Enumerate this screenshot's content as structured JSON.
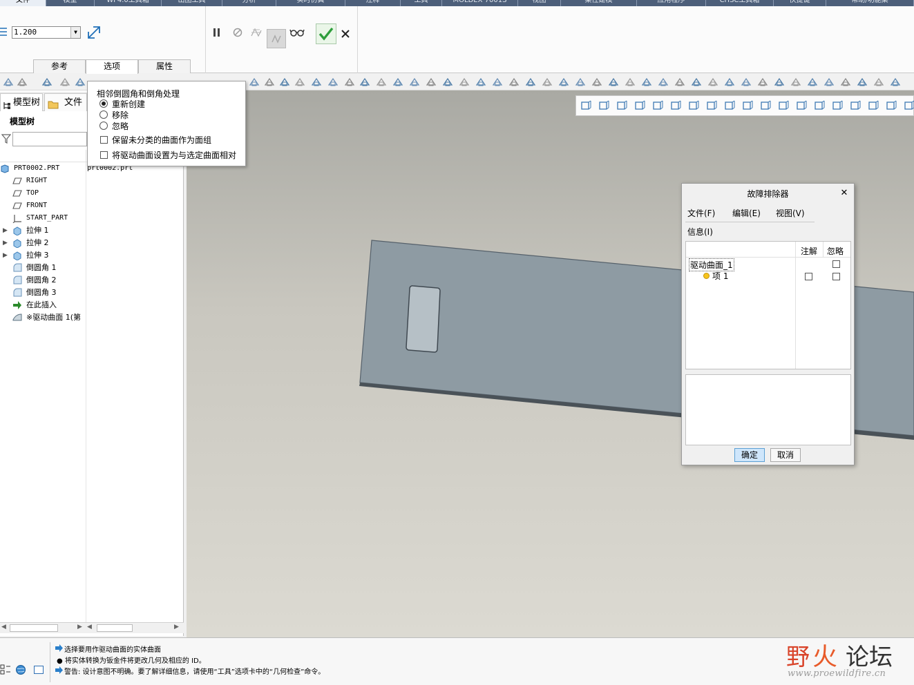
{
  "ribbon_tabs": [
    "文件",
    "模型",
    "WF4.0工具箱",
    "出图工具",
    "分析",
    "实时仿真",
    "注释",
    "工具",
    "MOLDEX 7001S",
    "视图",
    "柔性建模",
    "应用程序",
    "CHSC工具箱",
    "快捷键",
    "帮助/功能集"
  ],
  "ribbon": {
    "value": "1.200",
    "subtabs": [
      "参考",
      "选项",
      "属性"
    ],
    "active_subtab": "选项"
  },
  "left_panel": {
    "tabs": [
      "模型树",
      "文件夹"
    ],
    "tree_title": "模型树",
    "shadow_text": "prt0002.prt",
    "items": [
      {
        "label": "PRT0002.PRT",
        "icon": "part-icon"
      },
      {
        "label": "RIGHT",
        "icon": "datum-plane-icon"
      },
      {
        "label": "TOP",
        "icon": "datum-plane-icon"
      },
      {
        "label": "FRONT",
        "icon": "datum-plane-icon"
      },
      {
        "label": "START_PART",
        "icon": "coordinate-system-icon"
      },
      {
        "label": "拉伸 1",
        "icon": "extrude-icon"
      },
      {
        "label": "拉伸 2",
        "icon": "extrude-icon"
      },
      {
        "label": "拉伸 3",
        "icon": "extrude-icon"
      },
      {
        "label": "倒圆角 1",
        "icon": "round-icon"
      },
      {
        "label": "倒圆角 2",
        "icon": "round-icon"
      },
      {
        "label": "倒圆角 3",
        "icon": "round-icon"
      },
      {
        "label": "在此插入",
        "icon": "insert-arrow-icon"
      },
      {
        "label": "※驱动曲面 1(第",
        "icon": "drive-surface-icon"
      }
    ]
  },
  "options_popup": {
    "title": "相邻倒圆角和倒角处理",
    "radios": [
      "重新创建",
      "移除",
      "忽略"
    ],
    "selected": "重新创建",
    "checkboxes": [
      "保留未分类的曲面作为面组",
      "将驱动曲面设置为与选定曲面相对"
    ]
  },
  "troubleshooter": {
    "title": "故障排除器",
    "menus": [
      "文件(F)",
      "编辑(E)",
      "视图(V)",
      "信息(I)"
    ],
    "columns": [
      "注解",
      "忽略"
    ],
    "rows": [
      {
        "label": "驱动曲面_1"
      },
      {
        "label": "项 1"
      }
    ],
    "ok": "确定",
    "cancel": "取消"
  },
  "status_messages": [
    "选择要用作驱动曲面的实体曲面",
    "● 将实体转换为钣金件将更改几何及相应的 ID。",
    "警告: 设计意图不明确。要了解详细信息，请使用“工具”选项卡中的“几何检查”命令。"
  ],
  "watermark": {
    "brand_a": "野",
    "brand_b": "火",
    "brand_c": "论坛",
    "url": "www.proewildfire.cn"
  },
  "colors": {
    "accent": "#1f8ad2",
    "confirm_green": "#2e9e3c",
    "part_face": "#8e9ba3",
    "brand_red": "#d9442a"
  }
}
